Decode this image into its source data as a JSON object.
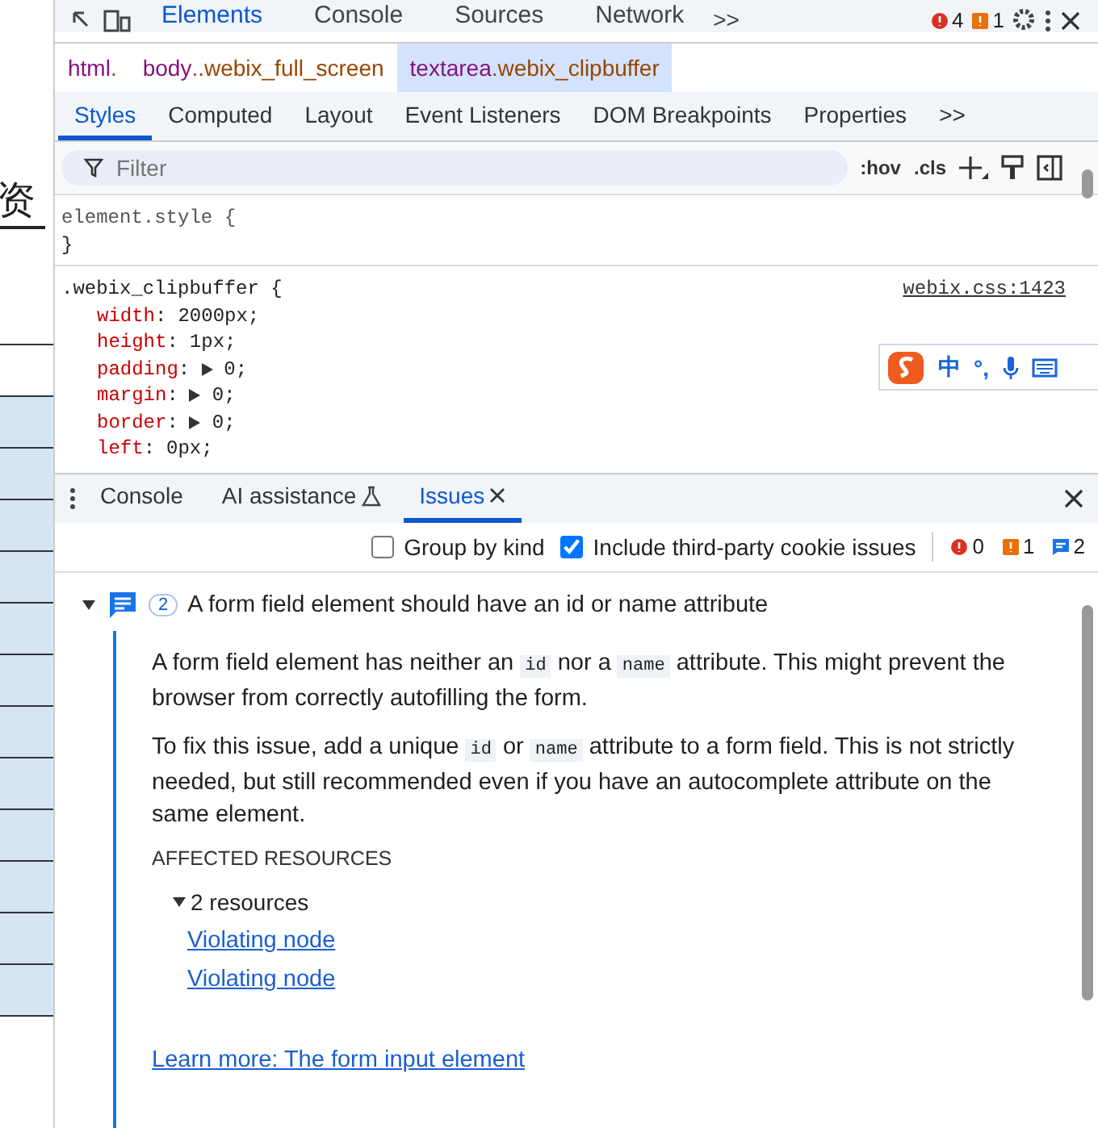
{
  "page_fragment": {
    "text": "资"
  },
  "main_tabs": [
    {
      "label": "Elements",
      "selected": true
    },
    {
      "label": "Console",
      "selected": false
    },
    {
      "label": "Sources",
      "selected": false
    },
    {
      "label": "Network",
      "selected": false
    }
  ],
  "more_tabs": ">>",
  "counters": [
    {
      "kind": "error",
      "count": "4"
    },
    {
      "kind": "warning",
      "count": "1"
    }
  ],
  "breadcrumbs": [
    {
      "tag": "html",
      "cls": ".",
      "selected": false
    },
    {
      "tag": "body",
      "cls": "..webix_full_screen",
      "selected": false
    },
    {
      "tag": "textarea",
      "cls": ".webix_clipbuffer",
      "selected": true
    }
  ],
  "sub_tabs": [
    {
      "label": "Styles",
      "selected": true
    },
    {
      "label": "Computed",
      "selected": false
    },
    {
      "label": "Layout",
      "selected": false
    },
    {
      "label": "Event Listeners",
      "selected": false
    },
    {
      "label": "DOM Breakpoints",
      "selected": false
    },
    {
      "label": "Properties",
      "selected": false
    }
  ],
  "sub_more": ">>",
  "filter": {
    "placeholder": "Filter",
    "hov": ":hov",
    "cls": ".cls"
  },
  "element_style": {
    "selector": "element.style {",
    "close": "}"
  },
  "rule": {
    "selector": ".webix_clipbuffer {",
    "source": "webix.css:1423",
    "properties": [
      {
        "name": "width",
        "colon": ":",
        "value": "2000px;",
        "expandable": false
      },
      {
        "name": "height",
        "colon": ":",
        "value": "1px;",
        "expandable": false
      },
      {
        "name": "padding",
        "colon": ":",
        "value": "0;",
        "expandable": true
      },
      {
        "name": "margin",
        "colon": ":",
        "value": "0;",
        "expandable": true
      },
      {
        "name": "border",
        "colon": ":",
        "value": "0;",
        "expandable": true
      },
      {
        "name": "left",
        "colon": ":",
        "value": "0px;",
        "expandable": false
      }
    ]
  },
  "ime": {
    "mode": "中",
    "punct": "°,"
  },
  "drawer_tabs": [
    {
      "label": "Console",
      "selected": false,
      "kind": "plain"
    },
    {
      "label": "AI assistance",
      "selected": false,
      "kind": "flask"
    },
    {
      "label": "Issues",
      "selected": true,
      "kind": "closable"
    }
  ],
  "options": [
    {
      "label": "Group by kind",
      "checked": false
    },
    {
      "label": "Include third-party cookie issues",
      "checked": true
    }
  ],
  "issue_counts": [
    {
      "kind": "error",
      "count": "0"
    },
    {
      "kind": "warning",
      "count": "1"
    },
    {
      "kind": "info",
      "count": "2"
    }
  ],
  "issue": {
    "expanded": true,
    "count": "2",
    "title": "A form field element should have an id or name attribute",
    "paragraphs": [
      [
        {
          "kind": "text",
          "text": "A form field element has neither an "
        },
        {
          "kind": "code",
          "text": "id"
        },
        {
          "kind": "text",
          "text": " nor a "
        },
        {
          "kind": "code",
          "text": "name"
        },
        {
          "kind": "text",
          "text": " attribute. This might prevent the browser from correctly autofilling the form."
        }
      ],
      [
        {
          "kind": "text",
          "text": "To fix this issue, add a unique "
        },
        {
          "kind": "code",
          "text": "id"
        },
        {
          "kind": "text",
          "text": " or "
        },
        {
          "kind": "code",
          "text": "name"
        },
        {
          "kind": "text",
          "text": " attribute to a form field. This is not strictly needed, but still recommended even if you have an autocomplete attribute on the same element."
        }
      ]
    ],
    "affected_heading": "AFFECTED RESOURCES",
    "resources": {
      "expanded": true,
      "label": "2 resources",
      "links": [
        "Violating node",
        "Violating node"
      ]
    },
    "learn_more": "Learn more: The form input element"
  }
}
